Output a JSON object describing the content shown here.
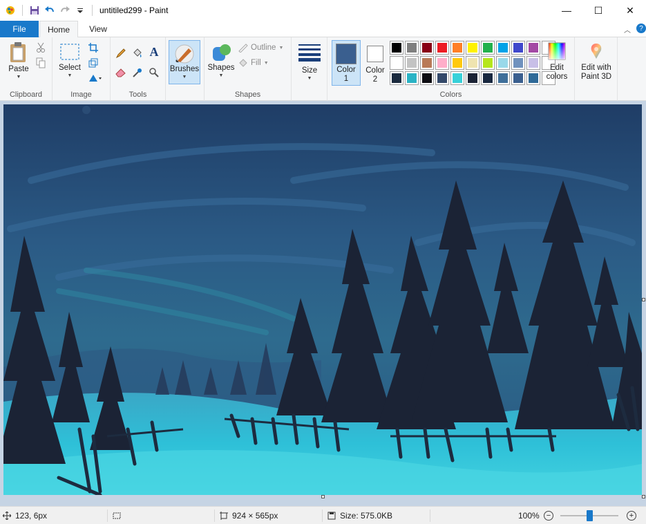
{
  "window": {
    "title": "untitiled299 - Paint",
    "minimize_glyph": "—",
    "maximize_glyph": "☐",
    "close_glyph": "✕"
  },
  "tabs": {
    "file": "File",
    "home": "Home",
    "view": "View"
  },
  "ribbon": {
    "clipboard": {
      "label": "Clipboard",
      "paste": "Paste"
    },
    "image": {
      "label": "Image",
      "select": "Select"
    },
    "tools": {
      "label": "Tools"
    },
    "brushes": "Brushes",
    "shapes": {
      "label": "Shapes",
      "shapes": "Shapes",
      "outline": "Outline",
      "fill": "Fill"
    },
    "size": "Size",
    "color1": {
      "line1": "Color",
      "line2": "1",
      "value": "#3a5f8f"
    },
    "color2": {
      "line1": "Color",
      "line2": "2",
      "value": "#ffffff"
    },
    "colors_label": "Colors",
    "edit_colors": {
      "line1": "Edit",
      "line2": "colors"
    },
    "edit_3d": {
      "line1": "Edit with",
      "line2": "Paint 3D"
    },
    "palette": [
      "#000000",
      "#7f7f7f",
      "#880015",
      "#ed1c24",
      "#ff7f27",
      "#fff200",
      "#22b14c",
      "#00a2e8",
      "#3f48cc",
      "#a349a4",
      "#ffffff",
      "#ffffff",
      "#c3c3c3",
      "#b97a57",
      "#ffaec9",
      "#ffc90e",
      "#efe4b0",
      "#b5e61d",
      "#99d9ea",
      "#7092be",
      "#c8bfe7",
      "#ffffff",
      "#1a2a3e",
      "#2ab3c5",
      "#0d0d12",
      "#34496a",
      "#38d1d9",
      "#1b2335",
      "#182840",
      "#3f6f9a",
      "#3a5f8f",
      "#2f6a98",
      "#ffffff"
    ]
  },
  "status": {
    "cursor": "123, 6px",
    "dimensions": "924 × 565px",
    "size": "Size: 575.0KB",
    "zoom": "100%",
    "zoom_out": "−",
    "zoom_in": "+"
  }
}
